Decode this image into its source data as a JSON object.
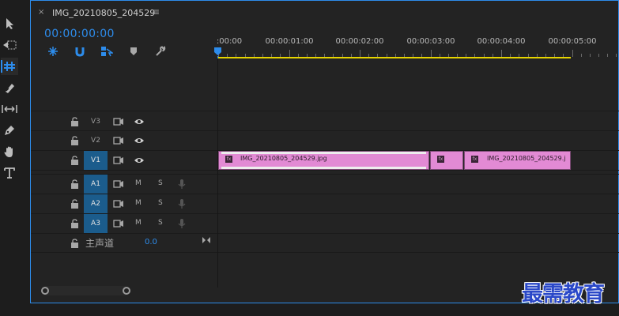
{
  "panel": {
    "tab_close": "×",
    "tab_title": "IMG_20210805_204529",
    "tab_menu": "≡"
  },
  "timecode": "00:00:00:00",
  "ruler": {
    "labels": [
      ":00:00",
      "00:00:01:00",
      "00:00:02:00",
      "00:00:03:00",
      "00:00:04:00",
      "00:00:05:00"
    ]
  },
  "tracks": {
    "video": [
      {
        "label": "V3",
        "selected": false
      },
      {
        "label": "V2",
        "selected": false
      },
      {
        "label": "V1",
        "selected": true
      }
    ],
    "audio": [
      {
        "label": "A1",
        "mute": "M",
        "solo": "S",
        "selected": true
      },
      {
        "label": "A2",
        "mute": "M",
        "solo": "S",
        "selected": true
      },
      {
        "label": "A3",
        "mute": "M",
        "solo": "S",
        "selected": true
      }
    ],
    "master": {
      "name": "主声道",
      "value": "0.0"
    }
  },
  "clips": [
    {
      "name": "IMG_20210805_204529.jpg",
      "fx": "fx"
    },
    {
      "name": "",
      "fx": "fx"
    },
    {
      "name": "IMG_20210805_204529.j",
      "fx": "fx"
    }
  ],
  "watermark": "最需教育",
  "colors": {
    "accent": "#2d8ceb",
    "clip": "#e28ad4",
    "track_selected": "#1b5c8c",
    "work_area": "#e6d500"
  },
  "tools": [
    "selection-icon",
    "track-select-icon",
    "ripple-edit-icon",
    "razor-icon",
    "slip-icon",
    "pen-icon",
    "hand-icon",
    "type-icon"
  ]
}
